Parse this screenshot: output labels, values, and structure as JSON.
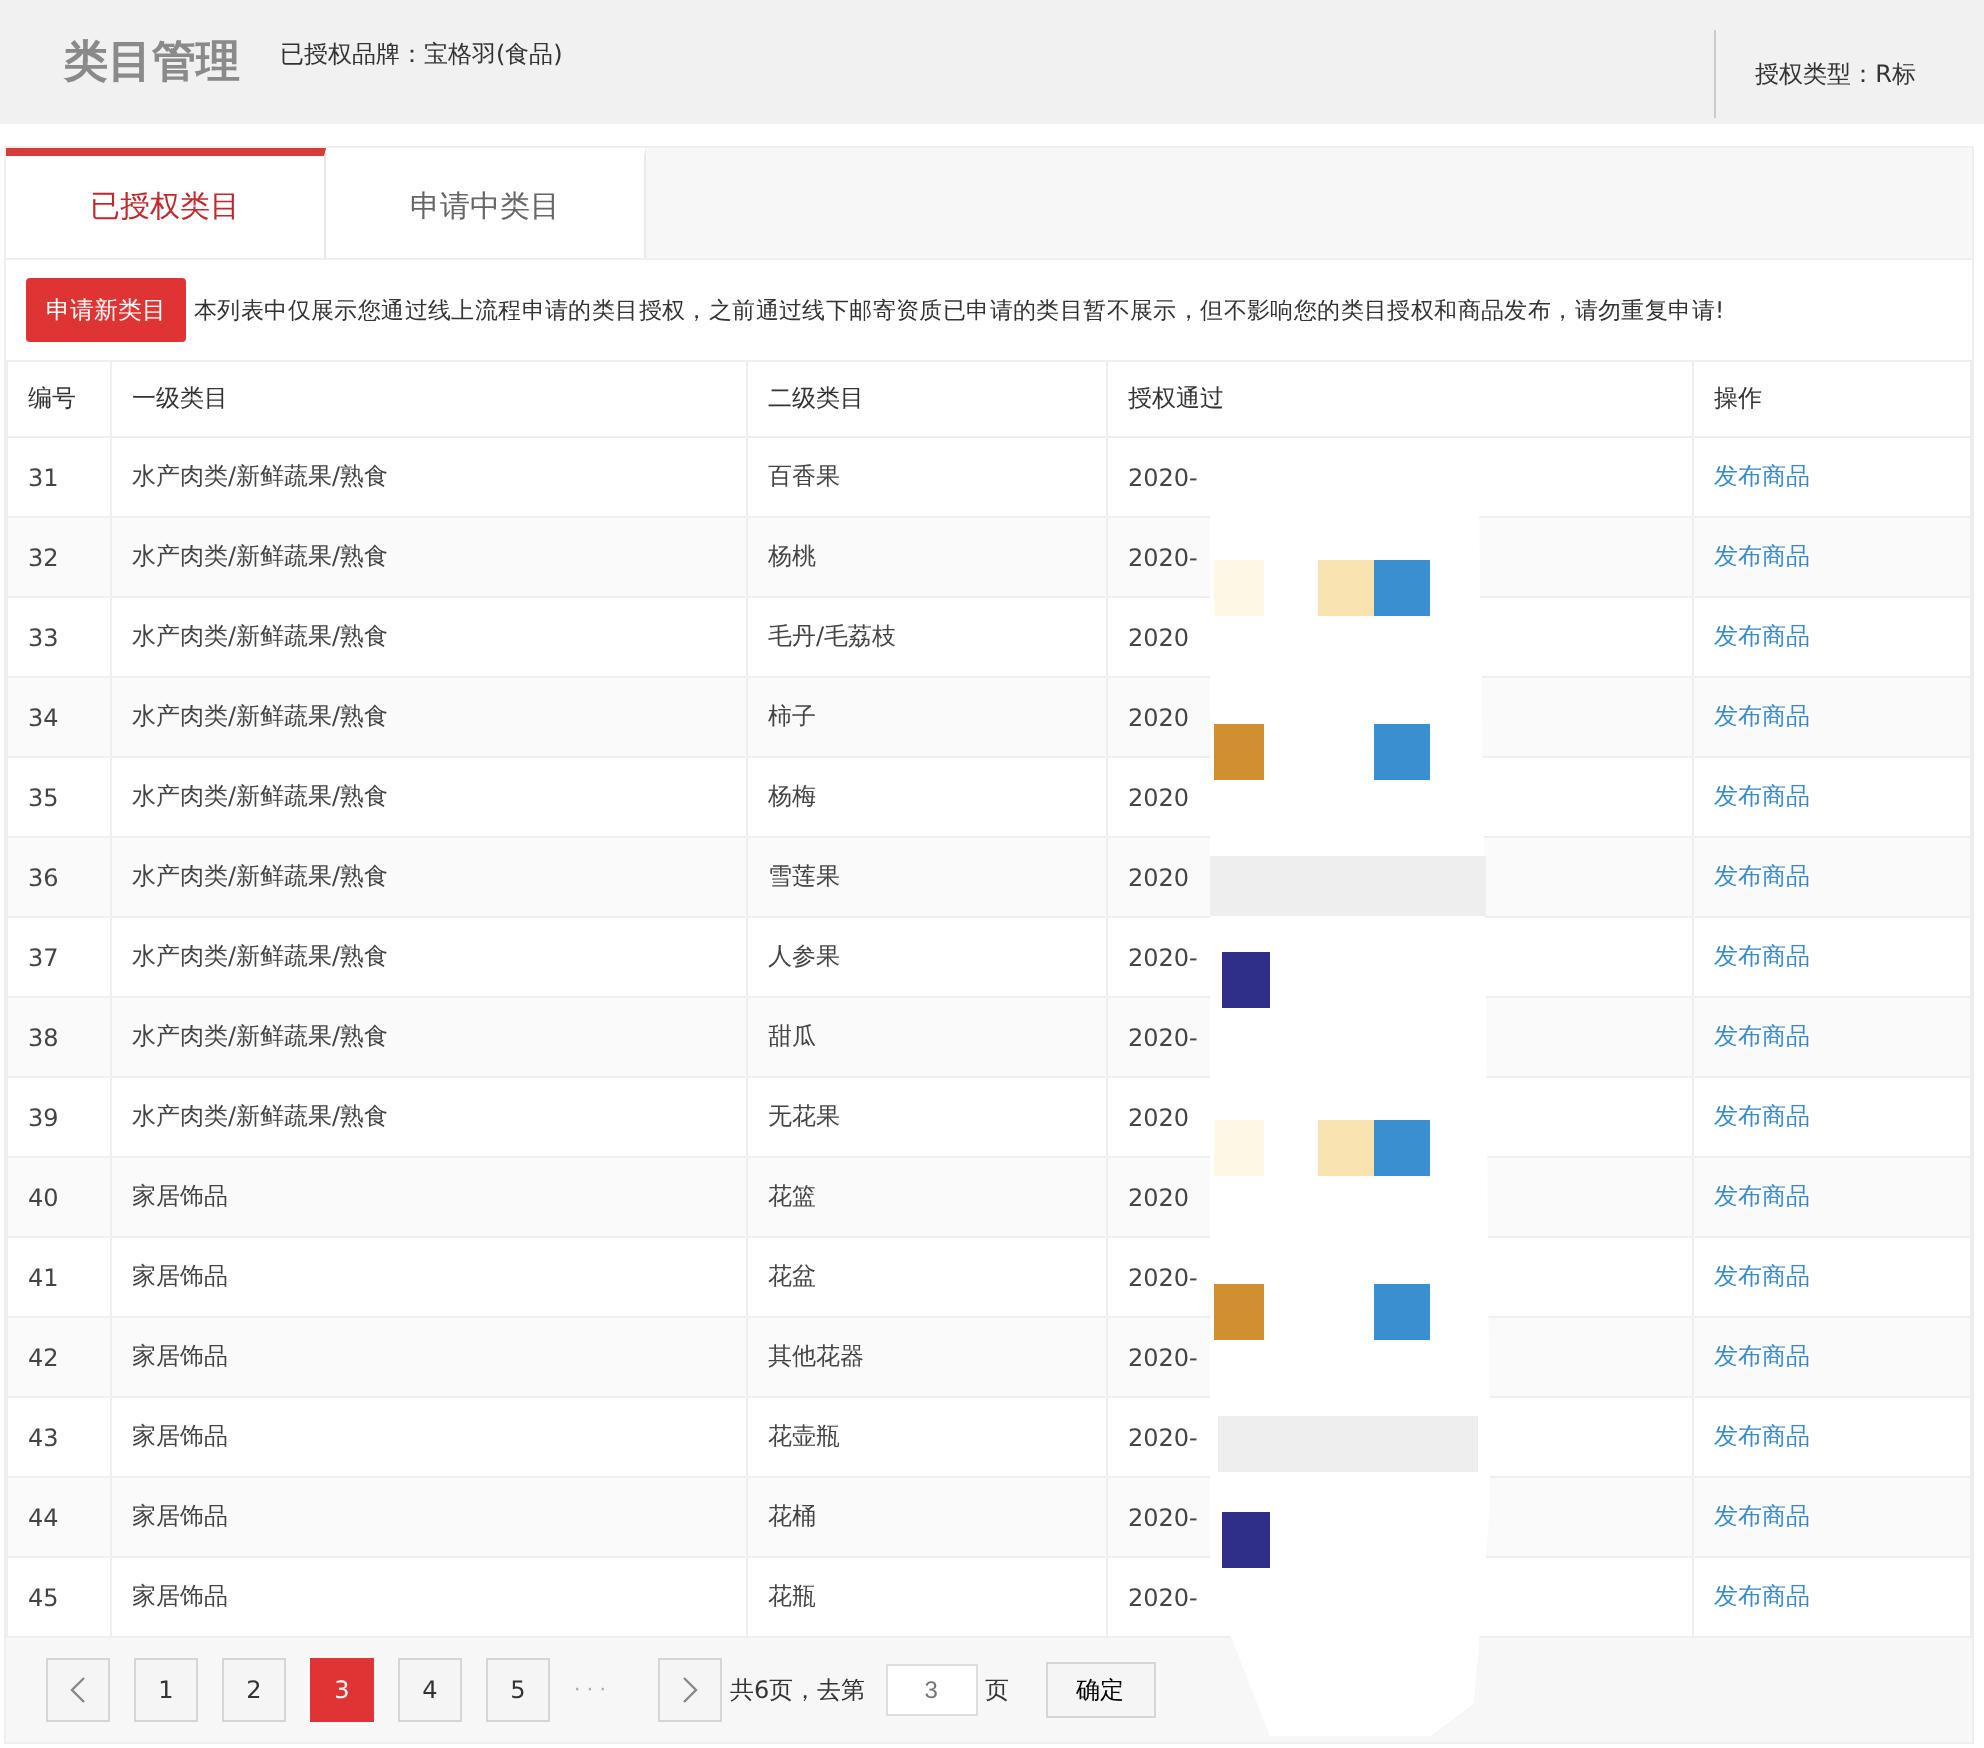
{
  "header": {
    "title": "类目管理",
    "brand": "已授权品牌：宝格羽(食品)",
    "auth_type": "授权类型：R标"
  },
  "tabs": [
    {
      "label": "已授权类目",
      "selected": true
    },
    {
      "label": "申请中类目",
      "selected": false
    }
  ],
  "apply_button": "申请新类目",
  "notice": "本列表中仅展示您通过线上流程申请的类目授权，之前通过线下邮寄资质已申请的类目暂不展示，但不影响您的类目授权和商品发布，请勿重复申请!",
  "table": {
    "columns": [
      "编号",
      "一级类目",
      "二级类目",
      "授权通过",
      "操作"
    ],
    "rows": [
      {
        "id": "31",
        "level1": "水产肉类/新鲜蔬果/熟食",
        "level2": "百香果",
        "date": "2020-",
        "action": "发布商品"
      },
      {
        "id": "32",
        "level1": "水产肉类/新鲜蔬果/熟食",
        "level2": "杨桃",
        "date": "2020-",
        "action": "发布商品"
      },
      {
        "id": "33",
        "level1": "水产肉类/新鲜蔬果/熟食",
        "level2": "毛丹/毛荔枝",
        "date": "2020",
        "action": "发布商品"
      },
      {
        "id": "34",
        "level1": "水产肉类/新鲜蔬果/熟食",
        "level2": "柿子",
        "date": "2020",
        "action": "发布商品"
      },
      {
        "id": "35",
        "level1": "水产肉类/新鲜蔬果/熟食",
        "level2": "杨梅",
        "date": "2020",
        "action": "发布商品"
      },
      {
        "id": "36",
        "level1": "水产肉类/新鲜蔬果/熟食",
        "level2": "雪莲果",
        "date": "2020",
        "action": "发布商品"
      },
      {
        "id": "37",
        "level1": "水产肉类/新鲜蔬果/熟食",
        "level2": "人参果",
        "date": "2020-",
        "action": "发布商品"
      },
      {
        "id": "38",
        "level1": "水产肉类/新鲜蔬果/熟食",
        "level2": "甜瓜",
        "date": "2020-",
        "action": "发布商品"
      },
      {
        "id": "39",
        "level1": "水产肉类/新鲜蔬果/熟食",
        "level2": "无花果",
        "date": "2020",
        "action": "发布商品"
      },
      {
        "id": "40",
        "level1": "家居饰品",
        "level2": "花篮",
        "date": "2020",
        "action": "发布商品"
      },
      {
        "id": "41",
        "level1": "家居饰品",
        "level2": "花盆",
        "date": "2020-",
        "action": "发布商品"
      },
      {
        "id": "42",
        "level1": "家居饰品",
        "level2": "其他花器",
        "date": "2020-",
        "action": "发布商品"
      },
      {
        "id": "43",
        "level1": "家居饰品",
        "level2": "花壶瓶",
        "date": "2020-",
        "action": "发布商品"
      },
      {
        "id": "44",
        "level1": "家居饰品",
        "level2": "花桶",
        "date": "2020-",
        "action": "发布商品"
      },
      {
        "id": "45",
        "level1": "家居饰品",
        "level2": "花瓶",
        "date": "2020-",
        "action": "发布商品"
      }
    ]
  },
  "pagination": {
    "pages": [
      {
        "label": "1",
        "selected": false
      },
      {
        "label": "2",
        "selected": false
      },
      {
        "label": "3",
        "selected": true
      },
      {
        "label": "4",
        "selected": false
      },
      {
        "label": "5",
        "selected": false
      }
    ],
    "ellipsis": "· · ·",
    "total": "共6页，去第",
    "goto_placeholder": "3",
    "page_suffix": "页",
    "confirm": "确定"
  }
}
